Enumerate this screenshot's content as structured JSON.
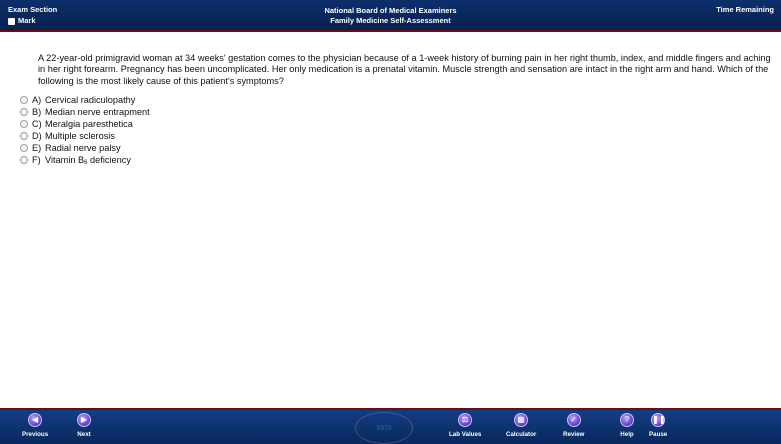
{
  "header": {
    "exam_section": "Exam Section",
    "mark_label": "Mark",
    "org_title": "National Board of Medical Examiners",
    "exam_title": "Family Medicine Self-Assessment",
    "time_remaining": "Time Remaining"
  },
  "question": {
    "stem": "A 22-year-old primigravid woman at 34 weeks' gestation comes to the physician because of a 1-week history of burning pain in her right thumb, index, and middle fingers and aching in her right forearm. Pregnancy has been uncomplicated. Her only medication is a prenatal vitamin. Muscle strength and sensation are intact in the right arm and hand. Which of the following is the most likely cause of this patient's symptoms?",
    "options": [
      {
        "letter": "A)",
        "text": "Cervical radiculopathy"
      },
      {
        "letter": "B)",
        "text": "Median nerve entrapment"
      },
      {
        "letter": "C)",
        "text": "Meralgia paresthetica"
      },
      {
        "letter": "D)",
        "text": "Multiple sclerosis"
      },
      {
        "letter": "E)",
        "text": "Radial nerve palsy"
      },
      {
        "letter": "F)",
        "text": "Vitamin B",
        "subscript": "6",
        "suffix": " deficiency"
      }
    ]
  },
  "footer": {
    "previous_label": "Previous",
    "next_label": "Next",
    "seal_text": "1915",
    "lab_values_label": "Lab Values",
    "calculator_label": "Calculator",
    "review_label": "Review",
    "help_label": "Help",
    "pause_label": "Pause"
  },
  "icons": {
    "previous": "arrow-left-icon",
    "next": "arrow-right-icon",
    "lab_values": "lab-values-icon",
    "calculator": "calculator-icon",
    "review": "review-icon",
    "help": "help-icon",
    "pause": "pause-icon"
  },
  "colors": {
    "header_bg": "#0b2a60",
    "footer_bg": "#0f3574",
    "accent_border": "#6d0a14",
    "button_purple": "#6a4bd6"
  }
}
